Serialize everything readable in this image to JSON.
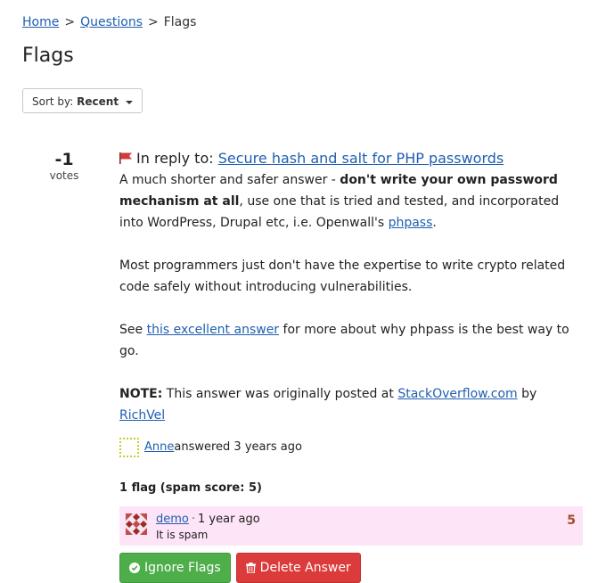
{
  "breadcrumb": {
    "home": "Home",
    "questions": "Questions",
    "current": "Flags",
    "sep1": ">",
    "sep2": ">"
  },
  "page": {
    "title": "Flags"
  },
  "sort": {
    "label": "Sort by:",
    "value": "Recent"
  },
  "post": {
    "votes": "-1",
    "votes_label": "votes",
    "in_reply_prefix": "In reply to:",
    "question_link": "Secure hash and salt for PHP passwords",
    "para1_start": "A much shorter and safer answer - ",
    "para1_bold": "don't write your own password mechanism at all",
    "para1_end": ", use one that is tried and tested, and incorporated into WordPress, Drupal etc, i.e. Openwall's ",
    "para1_link": "phpass",
    "para1_tail": ".",
    "para2": "Most programmers just don't have the expertise to write crypto related code safely without introducing vulnerabilities.",
    "para3_start": "See ",
    "para3_link": "this excellent answer",
    "para3_end": " for more about why phpass is the best way to go.",
    "note_label": "NOTE:",
    "note_text": " This answer was originally posted at ",
    "note_site": "StackOverflow.com",
    "note_by": " by ",
    "note_user": "RichVel",
    "author_name": "Anne",
    "author_action": " answered 3 years ago"
  },
  "flags": {
    "heading": "1 flag (spam score: 5)",
    "items": [
      {
        "user": "demo",
        "dot": "·",
        "time": "1 year ago",
        "reason": "It is spam",
        "score": "5"
      }
    ]
  },
  "actions": {
    "ignore": "Ignore Flags",
    "delete": "Delete Answer"
  },
  "colors": {
    "link": "#1f5fb0",
    "flag_bg": "#fde4f6",
    "ignore": "#4eae4a",
    "delete": "#dc3b3b",
    "score": "#a44b2b"
  }
}
